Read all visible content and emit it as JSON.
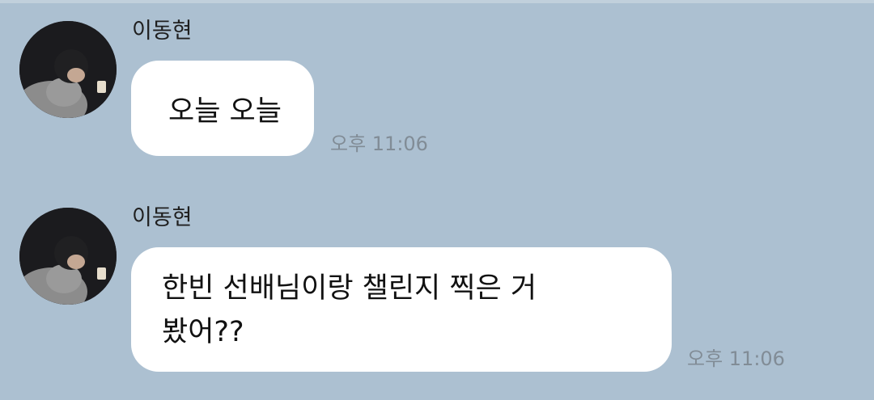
{
  "chat": {
    "messages": [
      {
        "sender": "이동현",
        "text": "오늘 오늘",
        "time": "오후 11:06",
        "avatar_icon": "profile-photo-icon"
      },
      {
        "sender": "이동현",
        "text": "한빈 선배님이랑 챌린지 찍은 거\n봤어??",
        "time": "오후 11:06",
        "avatar_icon": "profile-photo-icon"
      }
    ]
  },
  "colors": {
    "background": "#acc0d1",
    "bubble": "#ffffff",
    "time_text": "#818c96",
    "sender_text": "#1f1f1f"
  }
}
